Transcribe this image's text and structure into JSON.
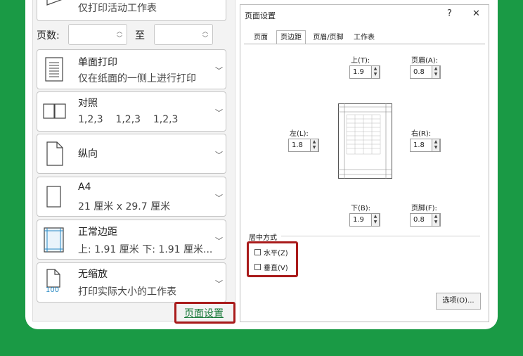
{
  "print_panel": {
    "print_what_sub": "仅打印活动工作表",
    "pages_label": "页数:",
    "to_label": "至",
    "sides": {
      "main": "单面打印",
      "sub": "仅在纸面的一侧上进行打印"
    },
    "collate": {
      "main": "对照",
      "sub": "1,2,3    1,2,3    1,2,3"
    },
    "orientation": {
      "main": "纵向"
    },
    "paper": {
      "main": "A4",
      "sub": "21 厘米 x 29.7 厘米"
    },
    "margins": {
      "main": "正常边距",
      "sub": "上: 1.91 厘米 下: 1.91 厘米..."
    },
    "scaling": {
      "main": "无缩放",
      "sub": "打印实际大小的工作表",
      "icon_text": "100"
    },
    "page_setup_link": "页面设置"
  },
  "dialog": {
    "title": "页面设置",
    "help": "?",
    "close": "✕",
    "tabs": [
      "页面",
      "页边距",
      "页眉/页脚",
      "工作表"
    ],
    "active_tab": 1,
    "margins": {
      "top_label": "上(T):",
      "top": "1.9",
      "header_label": "页眉(A):",
      "header": "0.8",
      "left_label": "左(L):",
      "left": "1.8",
      "right_label": "右(R):",
      "right": "1.8",
      "bottom_label": "下(B):",
      "bottom": "1.9",
      "footer_label": "页脚(F):",
      "footer": "0.8"
    },
    "center_section": "居中方式",
    "horizontal": "水平(Z)",
    "vertical": "垂直(V)",
    "options_button": "选项(O)..."
  },
  "colors": {
    "background": "#1a9a45",
    "highlight": "#a91b1b",
    "link": "#1a7a3a"
  }
}
